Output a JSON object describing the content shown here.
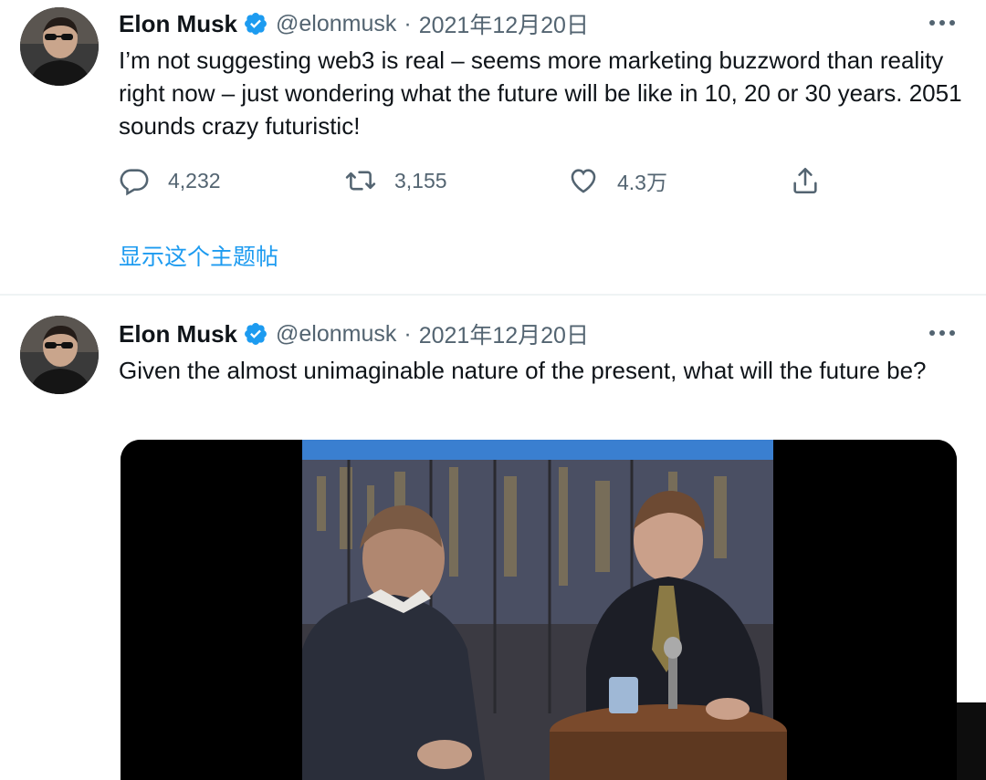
{
  "tweets": [
    {
      "author": {
        "name": "Elon Musk",
        "handle": "@elonmusk",
        "verified": true
      },
      "separator": "·",
      "date": "2021年12月20日",
      "text": "I’m not suggesting web3 is real – seems more marketing buzzword than reality right now – just wondering what the future will be like in 10, 20 or 30 years. 2051 sounds crazy futuristic!",
      "actions": {
        "reply": {
          "icon": "reply-icon",
          "count": "4,232"
        },
        "retweet": {
          "icon": "retweet-icon",
          "count": "3,155"
        },
        "like": {
          "icon": "heart-icon",
          "count": "4.3万"
        },
        "share": {
          "icon": "share-icon"
        }
      },
      "show_thread": "显示这个主题帖"
    },
    {
      "author": {
        "name": "Elon Musk",
        "handle": "@elonmusk",
        "verified": true
      },
      "separator": "·",
      "date": "2021年12月20日",
      "text": "Given the almost unimaginable nature of the present, what will the future be?",
      "media": {
        "type": "video",
        "thumbnail": "talk-show-interview"
      }
    }
  ],
  "colors": {
    "accent": "#1d9bf0",
    "text": "#0f1419",
    "secondary": "#536471",
    "divider": "#eff3f4"
  }
}
